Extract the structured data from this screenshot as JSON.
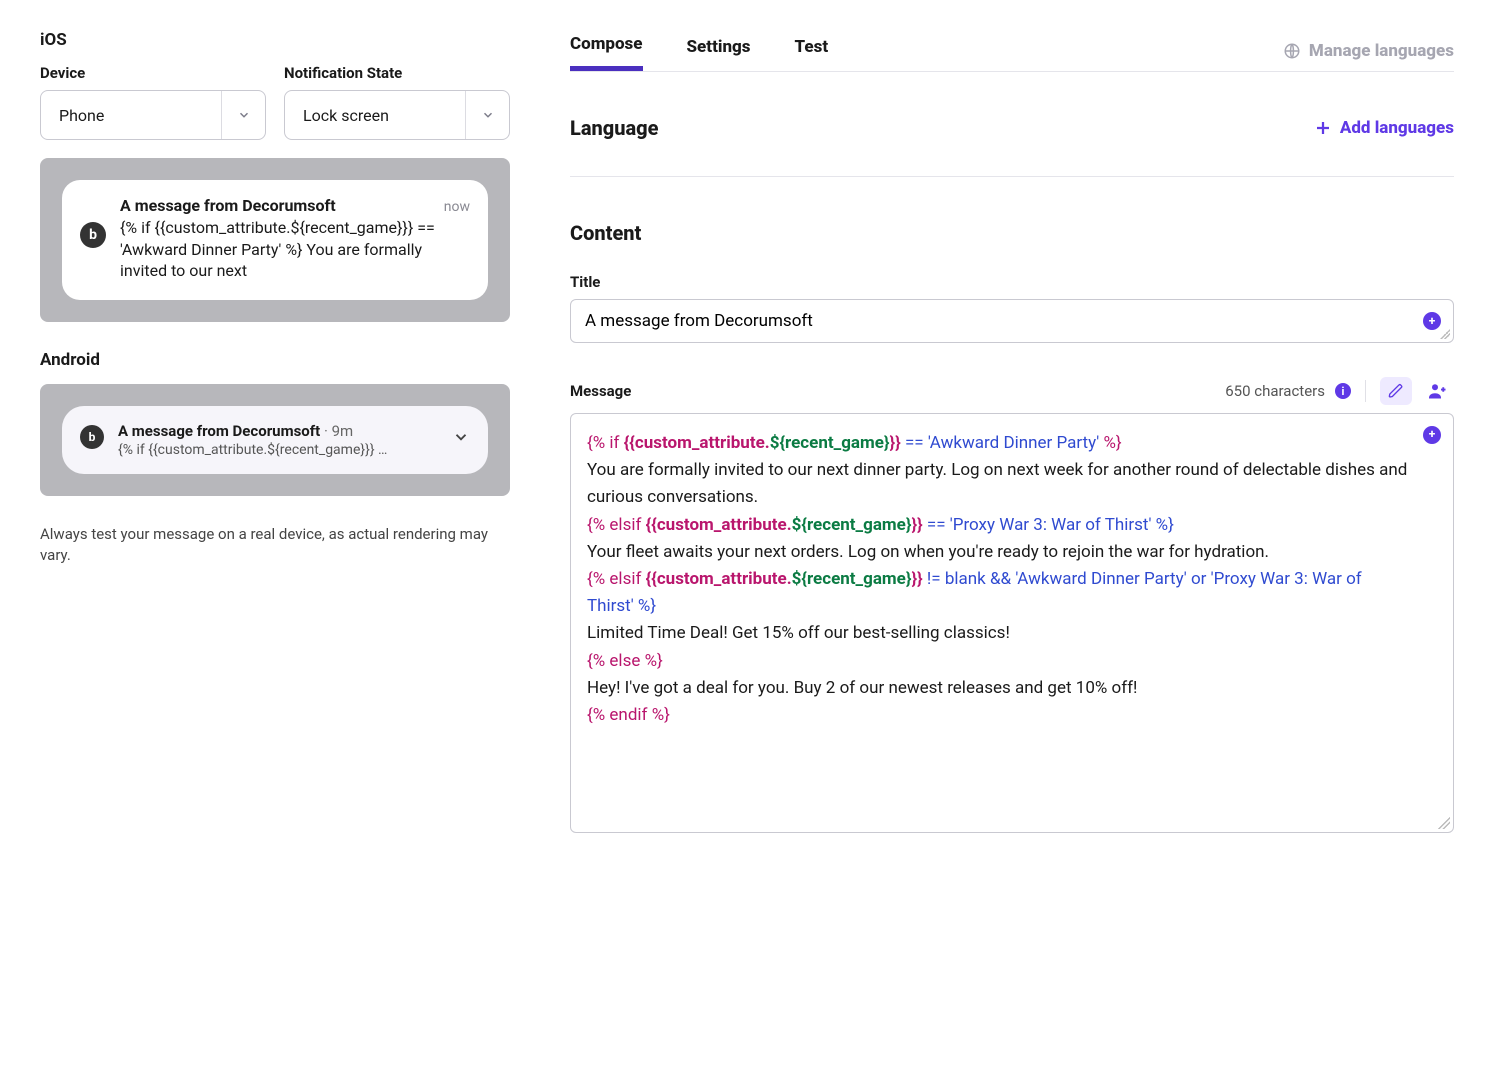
{
  "left": {
    "ios_heading": "iOS",
    "device_label": "Device",
    "state_label": "Notification State",
    "device_value": "Phone",
    "state_value": "Lock screen",
    "ios_notif": {
      "title": "A message from Decorumsoft",
      "time": "now",
      "body": "{% if {{custom_attribute.${recent_game}}} == 'Awkward Dinner Party' %} You are formally invited to our next"
    },
    "android_heading": "Android",
    "android_notif": {
      "title": "A message from Decorumsoft",
      "time": "9m",
      "snippet": "{% if {{custom_attribute.${recent_game}}} …"
    },
    "footnote": "Always test your message on a real device, as actual rendering may vary."
  },
  "tabs": {
    "compose": "Compose",
    "settings": "Settings",
    "test": "Test",
    "manage": "Manage languages"
  },
  "language": {
    "heading": "Language",
    "add": "Add languages"
  },
  "content": {
    "heading": "Content",
    "title_label": "Title",
    "title_value": "A message from Decorumsoft",
    "message_label": "Message",
    "char_count": "650 characters",
    "code": {
      "l1a": "{% ",
      "l1b": "if ",
      "l1c": "{{custom_attribute",
      "l1d": ".",
      "l1e": "${recent_game}",
      "l1f": "}}",
      "l1g": " == ",
      "l1h": "'Awkward Dinner Party'",
      "l2": "%}",
      "l3": "You are formally invited to our next dinner party. Log on next week for another round of delectable dishes and curious conversations.",
      "l4a": "{% ",
      "l4b": "elsif ",
      "l4c": "{{custom_attribute",
      "l4d": ".",
      "l4e": "${recent_game}",
      "l4f": "}}",
      "l4g": " == ",
      "l4h": "'Proxy War 3: War of Thirst' %}",
      "l5": "Your fleet awaits your next orders. Log on when you're ready to rejoin the war for hydration.",
      "l6a": "{% ",
      "l6b": "elsif ",
      "l6c": "{{custom_attribute",
      "l6d": ".",
      "l6e": "${recent_game}",
      "l6f": "}}",
      "l6g": " != ",
      "l6h": "blank && 'Awkward Dinner Party' or 'Proxy War 3: War of Thirst' %}",
      "l7": "Limited Time Deal! Get 15% off our best-selling classics!",
      "l8a": "{% ",
      "l8b": "else ",
      "l8c": "%}",
      "l9": "Hey! I've got a deal for you. Buy 2 of our newest releases and get 10% off!",
      "l10a": "{% ",
      "l10b": "endif ",
      "l10c": "%}"
    }
  }
}
